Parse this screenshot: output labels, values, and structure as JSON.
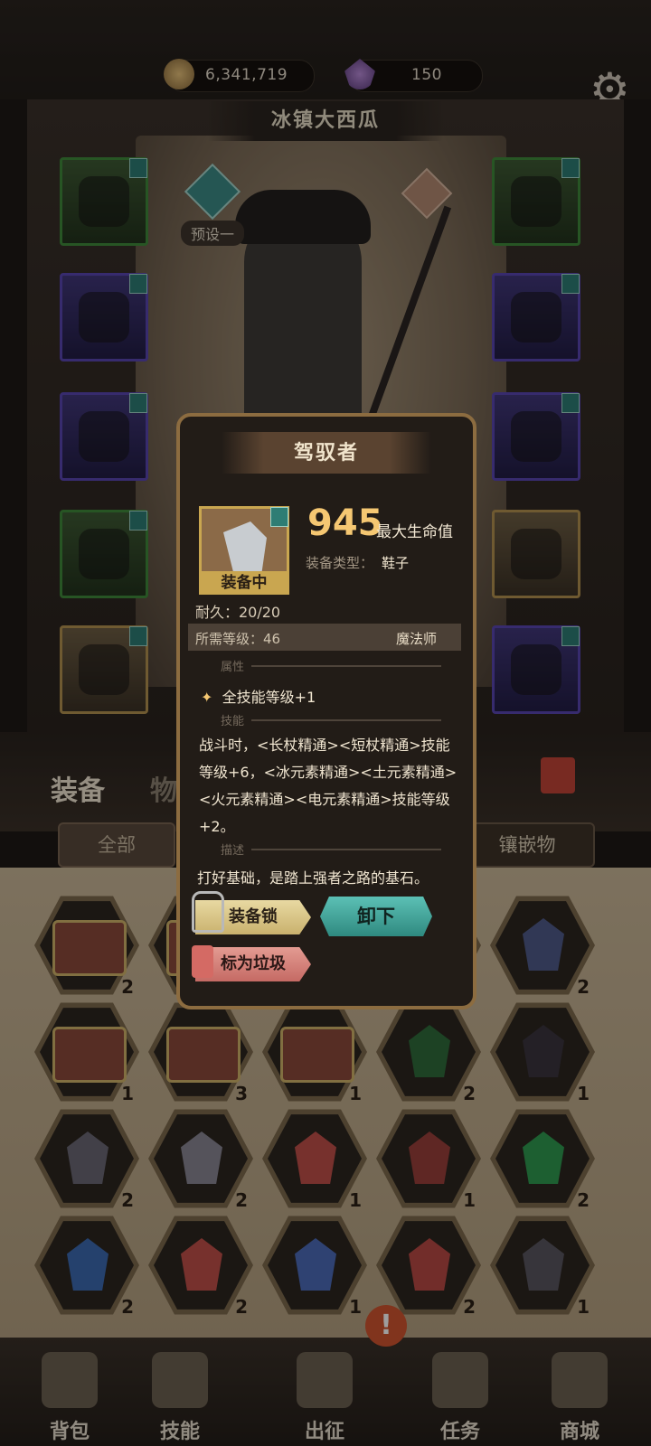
{
  "currency": {
    "gold": "6,341,719",
    "gems": "150",
    "gold_icon": "gold-coin-icon",
    "gem_icon": "purple-crystal-icon"
  },
  "settings_icon": "gear-icon",
  "character": {
    "name": "冰镇大西瓜",
    "preset": "预设一"
  },
  "tabs": {
    "equipment": "装备",
    "items": "物"
  },
  "filters": {
    "all": "全部",
    "gems": "镶嵌物"
  },
  "inventory": [
    {
      "kind": "chest",
      "count": "2"
    },
    {
      "kind": "chest",
      "count": ""
    },
    {
      "kind": "hidden",
      "count": ""
    },
    {
      "kind": "hidden",
      "count": ""
    },
    {
      "kind": "gem",
      "color": "#4f5b8a",
      "count": "2"
    },
    {
      "kind": "chest",
      "count": "1"
    },
    {
      "kind": "chest",
      "count": "3"
    },
    {
      "kind": "chest",
      "count": "1"
    },
    {
      "kind": "gem",
      "color": "#2f6b3a",
      "count": "2"
    },
    {
      "kind": "gem",
      "color": "#3a353e",
      "count": "1"
    },
    {
      "kind": "gem",
      "color": "#6b6874",
      "count": "2"
    },
    {
      "kind": "gem",
      "color": "#8a8794",
      "count": "2"
    },
    {
      "kind": "gem",
      "color": "#c0504a",
      "count": "1"
    },
    {
      "kind": "gem",
      "color": "#9a3f3a",
      "count": "1"
    },
    {
      "kind": "gem",
      "color": "#2f9a4f",
      "count": "2"
    },
    {
      "kind": "gem",
      "color": "#3c6ab0",
      "count": "2"
    },
    {
      "kind": "gem",
      "color": "#c0504a",
      "count": "2"
    },
    {
      "kind": "gem",
      "color": "#4c6bb8",
      "count": "1"
    },
    {
      "kind": "gem",
      "color": "#b84a44",
      "count": "2"
    },
    {
      "kind": "gem",
      "color": "#5a5660",
      "count": "1"
    }
  ],
  "nav": [
    {
      "label": "背包",
      "icon": "backpack-icon"
    },
    {
      "label": "技能",
      "icon": "skill-book-icon"
    },
    {
      "label": "出征",
      "icon": "sword-map-icon"
    },
    {
      "label": "任务",
      "icon": "scroll-icon"
    },
    {
      "label": "商城",
      "icon": "shop-crown-icon"
    }
  ],
  "alert_badge": "!",
  "popup": {
    "title": "驾驭者",
    "equipped_label": "装备中",
    "stat_value": "945",
    "stat_name": "最大生命值",
    "type_label": "装备类型：",
    "type_value": "鞋子",
    "durability": "耐久：20/20",
    "required_level_label": "所需等级：46",
    "required_class": "魔法师",
    "section_attr": "属性",
    "attribute_line": "全技能等级+1",
    "section_skill": "技能",
    "skill_description": "战斗时，<长杖精通><短杖精通>技能等级+6，<冰元素精通><土元素精通><火元素精通><电元素精通>技能等级+2。",
    "section_desc": "描述",
    "description": "打好基础，是踏上强者之路的基石。",
    "lock_button": "装备锁",
    "unequip_button": "卸下",
    "junk_button": "标为垃圾"
  }
}
